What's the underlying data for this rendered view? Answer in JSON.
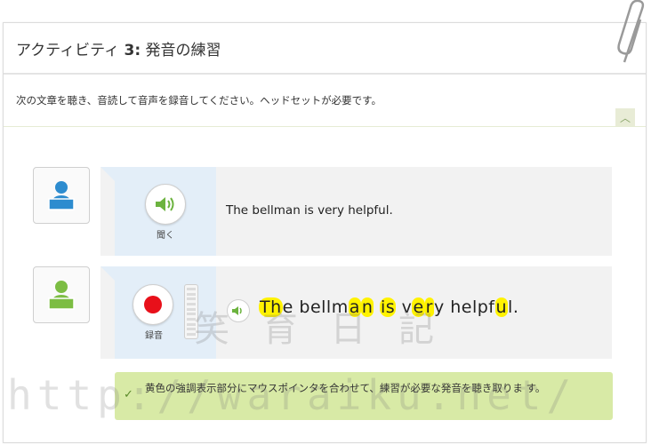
{
  "header": {
    "title_prefix": "アクティビティ ",
    "title_number": "3:",
    "title_suffix": " 発音の練習"
  },
  "instructions": "次の文章を聴き、音読して音声を録音してください。ヘッドセットが必要です。",
  "listen_row": {
    "button_label": "聞く",
    "sentence": "The bellman is very helpful."
  },
  "record_row": {
    "button_label": "録音",
    "sentence_parts": [
      {
        "t": "Th",
        "hl": true
      },
      {
        "t": "e bellm",
        "hl": false
      },
      {
        "t": "a",
        "hl": true
      },
      {
        "t": "n",
        "hl": true
      },
      {
        "t": " ",
        "hl": false
      },
      {
        "t": "is",
        "hl": true
      },
      {
        "t": " v",
        "hl": false
      },
      {
        "t": "e",
        "hl": true
      },
      {
        "t": "r",
        "hl": true
      },
      {
        "t": "y helpf",
        "hl": false
      },
      {
        "t": "u",
        "hl": true
      },
      {
        "t": "l.",
        "hl": false
      }
    ]
  },
  "tip": "黄色の強調表示部分にマウスポインタを合わせて、練習が必要な発音を聴き取りま す。",
  "watermark": {
    "line1": "笑 育 日 記",
    "line2": "http://waraiku.net/"
  },
  "colors": {
    "highlight": "#fff200",
    "tip_bg": "#d8eaa6",
    "record_red": "#e8101a",
    "speaker_green": "#6cb33f",
    "avatar_blue": "#2d8ccf",
    "avatar_green": "#7cbd43"
  }
}
